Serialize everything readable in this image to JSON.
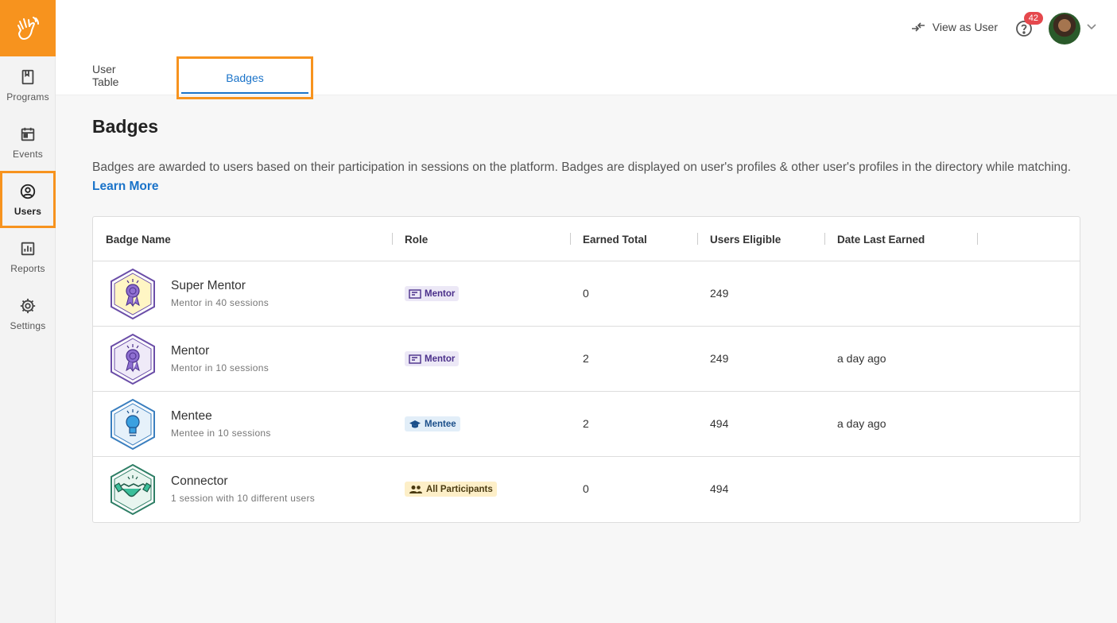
{
  "sidebar": {
    "items": [
      {
        "label": "Programs",
        "icon": "bookmark-icon"
      },
      {
        "label": "Events",
        "icon": "calendar-icon"
      },
      {
        "label": "Users",
        "icon": "user-circle-icon",
        "active": true
      },
      {
        "label": "Reports",
        "icon": "chart-icon"
      },
      {
        "label": "Settings",
        "icon": "gear-icon"
      }
    ]
  },
  "header": {
    "view_as_user": "View as User",
    "notification_count": "42"
  },
  "tabs": [
    {
      "label": "User Table"
    },
    {
      "label": "Badges",
      "active": true
    }
  ],
  "main": {
    "title": "Badges",
    "description": "Badges are awarded to users based on their participation in sessions on the platform. Badges are displayed on user's profiles & other user's profiles in the directory while matching.",
    "learn_more": "Learn More"
  },
  "table": {
    "columns": [
      "Badge Name",
      "Role",
      "Earned Total",
      "Users Eligible",
      "Date Last Earned"
    ],
    "rows": [
      {
        "name": "Super Mentor",
        "desc": "Mentor in 40 sessions",
        "role": "Mentor",
        "earned": "0",
        "eligible": "249",
        "last": ""
      },
      {
        "name": "Mentor",
        "desc": "Mentor in 10 sessions",
        "role": "Mentor",
        "earned": "2",
        "eligible": "249",
        "last": "a day ago"
      },
      {
        "name": "Mentee",
        "desc": "Mentee in 10 sessions",
        "role": "Mentee",
        "earned": "2",
        "eligible": "494",
        "last": "a day ago"
      },
      {
        "name": "Connector",
        "desc": "1 session with 10 different users",
        "role": "All Participants",
        "earned": "0",
        "eligible": "494",
        "last": ""
      }
    ]
  },
  "colors": {
    "accent": "#f7931e",
    "link": "#1a73c9",
    "notification": "#e5484d"
  }
}
